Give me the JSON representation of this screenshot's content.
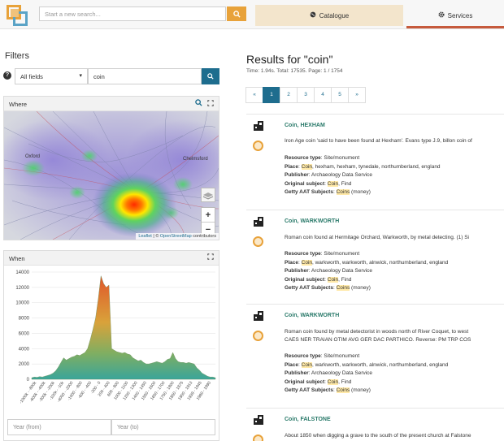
{
  "header": {
    "search_placeholder": "Start a new search...",
    "tabs": [
      {
        "label": "Catalogue",
        "icon": "globe-icon"
      },
      {
        "label": "Services",
        "icon": "gear-icon"
      }
    ]
  },
  "filters": {
    "title": "Filters",
    "field_select": "All fields",
    "query": "coin"
  },
  "where": {
    "title": "Where",
    "attribution_leaflet": "Leaflet",
    "attribution_sep": " | © ",
    "attribution_osm": "OpenStreetMap",
    "attribution_tail": " contributors",
    "map_labels": [
      "Oxford",
      "Chelmsford"
    ]
  },
  "when": {
    "title": "When",
    "year_from_placeholder": "Year (from)",
    "year_to_placeholder": "Year (to)"
  },
  "chart_data": {
    "type": "area",
    "title": "When",
    "y_ticks": [
      0,
      2000,
      4000,
      6000,
      8000,
      10000,
      12000,
      14000
    ],
    "ylim": [
      0,
      14000
    ],
    "x_ticks": [
      "-1000k - -800k",
      "-600k - -400k",
      "-300k - -200k",
      "-100k - -10k",
      "-4000 - -2000",
      "-1000 - -800",
      "-600 - -400",
      "-200 - 0",
      "200 - 400",
      "600 - 800",
      "1000 - 1100",
      "1200 - 1300",
      "1400 - 1450",
      "1550 - 1600",
      "1650 - 1700",
      "1750 - 1800",
      "1850 - 1875",
      "1900 - 1913",
      "1939 - 1945",
      "1980 - 1990"
    ],
    "values": [
      200,
      300,
      250,
      350,
      300,
      400,
      500,
      600,
      800,
      1100,
      1600,
      2200,
      2800,
      2500,
      2700,
      2900,
      3000,
      3200,
      3100,
      3300,
      3500,
      4000,
      5200,
      6500,
      8000,
      10500,
      13500,
      12500,
      12000,
      12300,
      4000,
      3800,
      3600,
      3500,
      3400,
      3500,
      3300,
      3200,
      2800,
      2600,
      2400,
      2500,
      2200,
      2000,
      2000,
      2100,
      2200,
      2300,
      2200,
      2100,
      2300,
      2600,
      2700,
      3500,
      2700,
      2300,
      2200,
      2200,
      2100,
      2200,
      2100,
      2000,
      1500,
      1200,
      800,
      600,
      400,
      300,
      300,
      200
    ]
  },
  "results": {
    "title": "Results for \"coin\"",
    "meta": "Time: 1.94s. Total: 17535. Page: 1 / 1754",
    "pager": [
      "«",
      "1",
      "2",
      "3",
      "4",
      "5",
      "»"
    ],
    "items": [
      {
        "title": "Coin, HEXHAM",
        "desc": "Iron Age coin 'said to have been found at Hexham'. Evans type J.9, billon coin of",
        "desc2": "",
        "resource_label": "Resource type",
        "resource": "Site/monument",
        "place_label": "Place",
        "place_hl": "Coin",
        "place": ", hexham, hexham, tynedale, northumberland, england",
        "publisher_label": "Publisher",
        "publisher": "Archaeology Data Service",
        "subject_label": "Original subject",
        "subject_hl": "Coin",
        "subject": ", Find",
        "aat_label": "Getty AAT Subjects",
        "aat_hl": "Coins",
        "aat": " (money)"
      },
      {
        "title": "Coin, WARKWORTH",
        "desc": "Roman coin found at Hermitage Orchard, Warkworth, by metal detecting. (1) Si",
        "desc2": "",
        "resource_label": "Resource type",
        "resource": "Site/monument",
        "place_label": "Place",
        "place_hl": "Coin",
        "place": ", warkworth, warkworth, alnwick, northumberland, england",
        "publisher_label": "Publisher",
        "publisher": "Archaeology Data Service",
        "subject_label": "Original subject",
        "subject_hl": "Coin",
        "subject": ", Find",
        "aat_label": "Getty AAT Subjects",
        "aat_hl": "Coins",
        "aat": " (money)"
      },
      {
        "title": "Coin, WARKWORTH",
        "desc": "Roman coin found by metal detectorist in woods north of River Coquet, to west",
        "desc2": "CAES NER TRAIAN OTIM AVG GER DAC PARTHICO. Reverse: PM TRP COS",
        "resource_label": "Resource type",
        "resource": "Site/monument",
        "place_label": "Place",
        "place_hl": "Coin",
        "place": ", warkworth, warkworth, alnwick, northumberland, england",
        "publisher_label": "Publisher",
        "publisher": "Archaeology Data Service",
        "subject_label": "Original subject",
        "subject_hl": "Coin",
        "subject": ", Find",
        "aat_label": "Getty AAT Subjects",
        "aat_hl": "Coins",
        "aat": " (money)"
      },
      {
        "title": "Coin, FALSTONE",
        "desc": "About 1850 when digging a grave to the south of the present church at Falstone",
        "desc2": ""
      }
    ]
  },
  "colors": {
    "accent_orange": "#e8a23a",
    "teal": "#1e6d8e",
    "title_green": "#2a7a6a",
    "highlight": "#ffe9a8"
  }
}
